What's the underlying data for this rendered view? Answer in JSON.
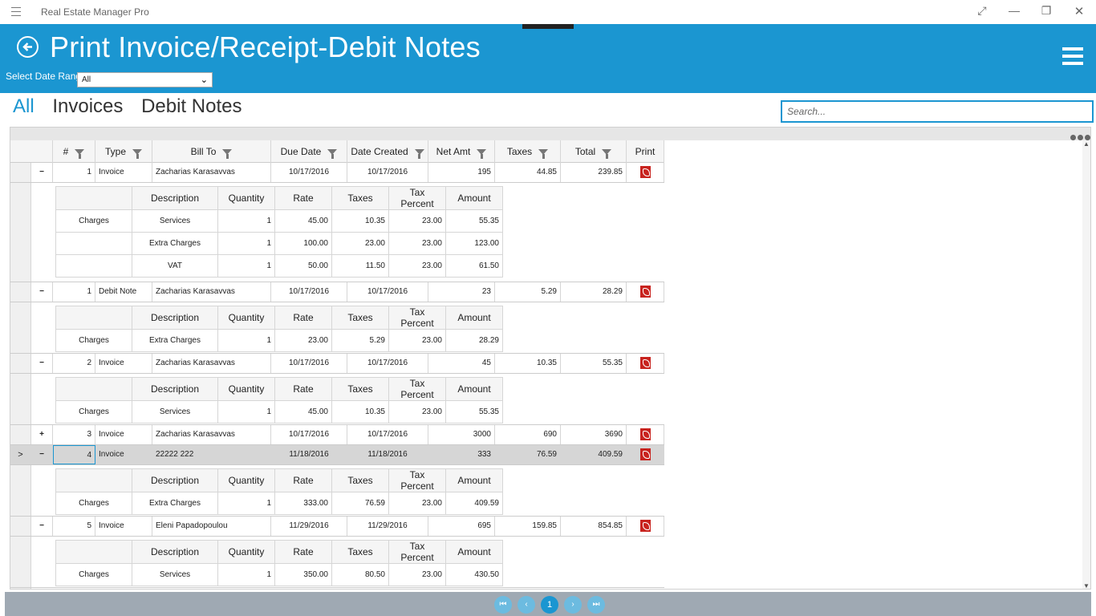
{
  "window": {
    "app_title": "Real Estate Manager Pro"
  },
  "header": {
    "title": "Print Invoice/Receipt-Debit Notes",
    "date_range_label": "Select Date Range:",
    "date_range_value": "All"
  },
  "tabs": [
    {
      "label": "All",
      "active": true
    },
    {
      "label": "Invoices"
    },
    {
      "label": "Debit Notes"
    }
  ],
  "search": {
    "placeholder": "Search..."
  },
  "grid": {
    "columns": [
      "#",
      "Type",
      "Bill To",
      "Due Date",
      "Date Created",
      "Net Amt",
      "Taxes",
      "Total",
      "Print"
    ],
    "sub_columns": [
      "Description",
      "Quantity",
      "Rate",
      "Taxes",
      "Tax Percent",
      "Amount"
    ],
    "rows": [
      {
        "expander": "−",
        "num": "1",
        "type": "Invoice",
        "bill_to": "Zacharias Karasavvas",
        "due": "10/17/2016",
        "created": "10/17/2016",
        "net": "195",
        "taxes": "44.85",
        "total": "239.85",
        "details": [
          {
            "cat": "Charges",
            "desc": "Services",
            "qty": "1",
            "rate": "45.00",
            "taxes": "10.35",
            "pct": "23.00",
            "amount": "55.35"
          },
          {
            "cat": "",
            "desc": "Extra Charges",
            "qty": "1",
            "rate": "100.00",
            "taxes": "23.00",
            "pct": "23.00",
            "amount": "123.00"
          },
          {
            "cat": "",
            "desc": "VAT",
            "qty": "1",
            "rate": "50.00",
            "taxes": "11.50",
            "pct": "23.00",
            "amount": "61.50"
          }
        ]
      },
      {
        "expander": "−",
        "num": "1",
        "type": "Debit Note",
        "bill_to": "Zacharias Karasavvas",
        "due": "10/17/2016",
        "created": "10/17/2016",
        "net": "23",
        "taxes": "5.29",
        "total": "28.29",
        "details": [
          {
            "cat": "Charges",
            "desc": "Extra Charges",
            "qty": "1",
            "rate": "23.00",
            "taxes": "5.29",
            "pct": "23.00",
            "amount": "28.29"
          }
        ]
      },
      {
        "expander": "−",
        "num": "2",
        "type": "Invoice",
        "bill_to": "Zacharias Karasavvas",
        "due": "10/17/2016",
        "created": "10/17/2016",
        "net": "45",
        "taxes": "10.35",
        "total": "55.35",
        "details": [
          {
            "cat": "Charges",
            "desc": "Services",
            "qty": "1",
            "rate": "45.00",
            "taxes": "10.35",
            "pct": "23.00",
            "amount": "55.35"
          }
        ]
      },
      {
        "expander": "+",
        "num": "3",
        "type": "Invoice",
        "bill_to": "Zacharias Karasavvas",
        "due": "10/17/2016",
        "created": "10/17/2016",
        "net": "3000",
        "taxes": "690",
        "total": "3690",
        "details": []
      },
      {
        "expander": "−",
        "num": "4",
        "type": "Invoice",
        "bill_to": "22222 222",
        "due": "11/18/2016",
        "created": "11/18/2016",
        "net": "333",
        "taxes": "76.59",
        "total": "409.59",
        "selected": true,
        "row_indicator": ">",
        "details": [
          {
            "cat": "Charges",
            "desc": "Extra Charges",
            "qty": "1",
            "rate": "333.00",
            "taxes": "76.59",
            "pct": "23.00",
            "amount": "409.59"
          }
        ]
      },
      {
        "expander": "−",
        "num": "5",
        "type": "Invoice",
        "bill_to": "Eleni Papadopoulou",
        "due": "11/29/2016",
        "created": "11/29/2016",
        "net": "695",
        "taxes": "159.85",
        "total": "854.85",
        "details": [
          {
            "cat": "Charges",
            "desc": "Services",
            "qty": "1",
            "rate": "350.00",
            "taxes": "80.50",
            "pct": "23.00",
            "amount": "430.50"
          }
        ]
      }
    ]
  },
  "pager": {
    "current_page": "1",
    "first": "⏮",
    "prev": "‹",
    "next": "›",
    "last": "⏭"
  }
}
